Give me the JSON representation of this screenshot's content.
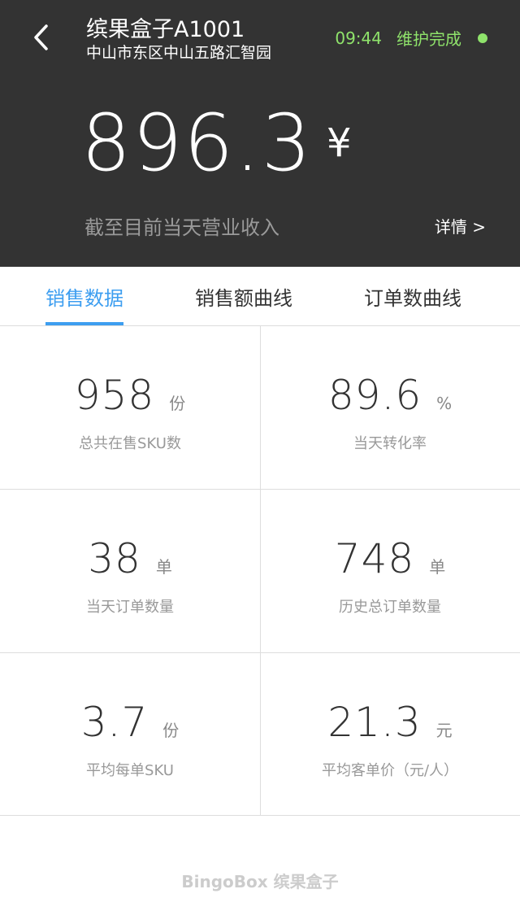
{
  "header": {
    "store_name": "缤果盒子A1001",
    "store_address": "中山市东区中山五路汇智园",
    "status_time": "09:44",
    "status_text": "维护完成",
    "status_color": "#8fe36b",
    "amount": "896.3",
    "currency": "¥",
    "subtitle": "截至目前当天营业收入",
    "detail_link": "详情 >",
    "background": "#333333"
  },
  "tabs": [
    {
      "label": "销售数据",
      "active": true
    },
    {
      "label": "销售额曲线",
      "active": false
    },
    {
      "label": "订单数曲线",
      "active": false
    }
  ],
  "accent_color": "#3d9ef0",
  "stats": [
    {
      "value": "958",
      "unit": "份",
      "label": "总共在售SKU数"
    },
    {
      "value": "89.6",
      "unit": "%",
      "label": "当天转化率"
    },
    {
      "value": "38",
      "unit": "单",
      "label": "当天订单数量"
    },
    {
      "value": "748",
      "unit": "单",
      "label": "历史总订单数量"
    },
    {
      "value": "3.7",
      "unit": "份",
      "label": "平均每单SKU"
    },
    {
      "value": "21.3",
      "unit": "元",
      "label": "平均客单价（元/人）"
    }
  ],
  "footer": {
    "logo_text": "BingoBox 缤果盒子"
  }
}
